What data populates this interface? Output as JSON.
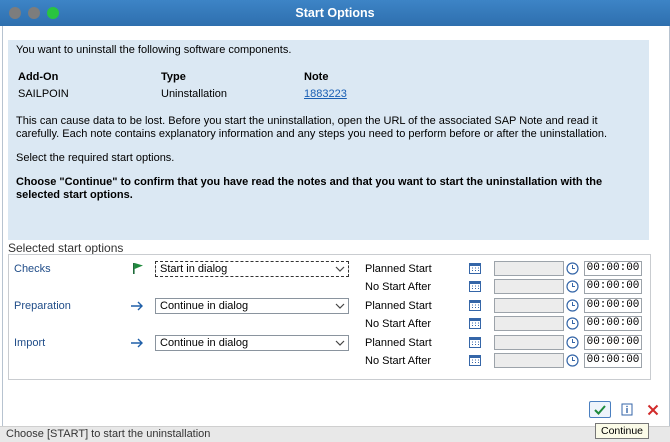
{
  "window": {
    "title": "Start Options"
  },
  "info": {
    "intro": "You want to uninstall the following software components.",
    "headers": {
      "addon": "Add-On",
      "type": "Type",
      "note": "Note"
    },
    "row": {
      "addon": "SAILPOIN",
      "type": "Uninstallation",
      "note": "1883223"
    },
    "warning_line1": "This can cause data to be lost. Before you start the uninstallation, open the URL of the associated SAP Note and read it",
    "warning_line2": "carefully. Each note contains explanatory information and any steps you need to perform before or after the uninstallation.",
    "select_text": "Select the required start options.",
    "confirm_line1": "Choose \"Continue\" to confirm that you have read the notes and that you want to start the uninstallation with the",
    "confirm_line2": "selected start options."
  },
  "section": {
    "title": "Selected start options",
    "planned_start_label": "Planned Start",
    "no_start_after_label": "No Start After",
    "time_default": "00:00:00",
    "rows": [
      {
        "label": "Checks",
        "icon": "flag-icon",
        "mode": "Start in dialog"
      },
      {
        "label": "Preparation",
        "icon": "arrow-right-icon",
        "mode": "Continue in dialog"
      },
      {
        "label": "Import",
        "icon": "arrow-right-icon",
        "mode": "Continue in dialog"
      }
    ]
  },
  "footer": {
    "tooltip": "Continue"
  },
  "statusbar": {
    "text": "Choose [START] to start the uninstallation"
  },
  "colors": {
    "title_bar": "#3d84c6",
    "info_bg": "#dbe8f3",
    "label": "#1f4c88",
    "accent_green": "#1e8a3c",
    "cancel_red": "#d12b2b"
  }
}
